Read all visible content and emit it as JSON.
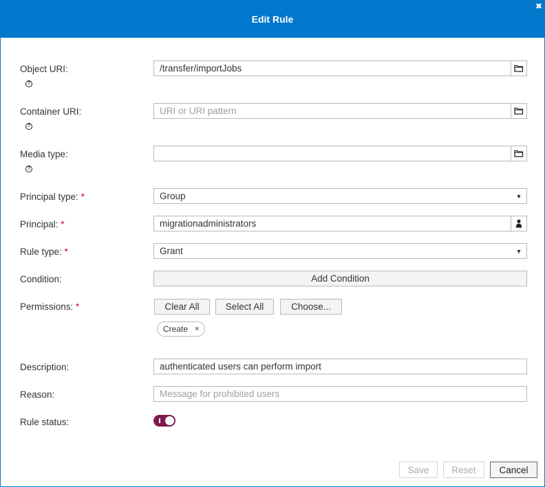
{
  "dialog": {
    "title": "Edit Rule",
    "close_glyph": "✖"
  },
  "form": {
    "object_uri": {
      "label": "Object URI:",
      "value": "/transfer/importJobs",
      "help_glyph": "?"
    },
    "container_uri": {
      "label": "Container URI:",
      "placeholder": "URI or URI pattern",
      "help_glyph": "?"
    },
    "media_type": {
      "label": "Media type:",
      "value": "",
      "help_glyph": "?"
    },
    "principal_type": {
      "label": "Principal type:",
      "required_mark": "*",
      "value": "Group",
      "caret": "▼"
    },
    "principal": {
      "label": "Principal:",
      "required_mark": "*",
      "value": "migrationadministrators"
    },
    "rule_type": {
      "label": "Rule type:",
      "required_mark": "*",
      "value": "Grant",
      "caret": "▼"
    },
    "condition": {
      "label": "Condition:",
      "button": "Add Condition"
    },
    "permissions": {
      "label": "Permissions:",
      "required_mark": "*",
      "clear_all": "Clear All",
      "select_all": "Select All",
      "choose": "Choose...",
      "chips": [
        {
          "label": "Create",
          "remove_glyph": "×"
        }
      ]
    },
    "description": {
      "label": "Description:",
      "value": "authenticated users can perform import"
    },
    "reason": {
      "label": "Reason:",
      "placeholder": "Message for prohibited users"
    },
    "rule_status": {
      "label": "Rule status:",
      "enabled": true,
      "accent": "#7e1a4d"
    }
  },
  "footer": {
    "save": "Save",
    "reset": "Reset",
    "cancel": "Cancel"
  },
  "colors": {
    "header": "#0378cd",
    "required": "#d0021b"
  },
  "icons": {
    "folder": "folder-icon",
    "user": "user-icon",
    "help": "help-icon",
    "close": "close-icon"
  }
}
